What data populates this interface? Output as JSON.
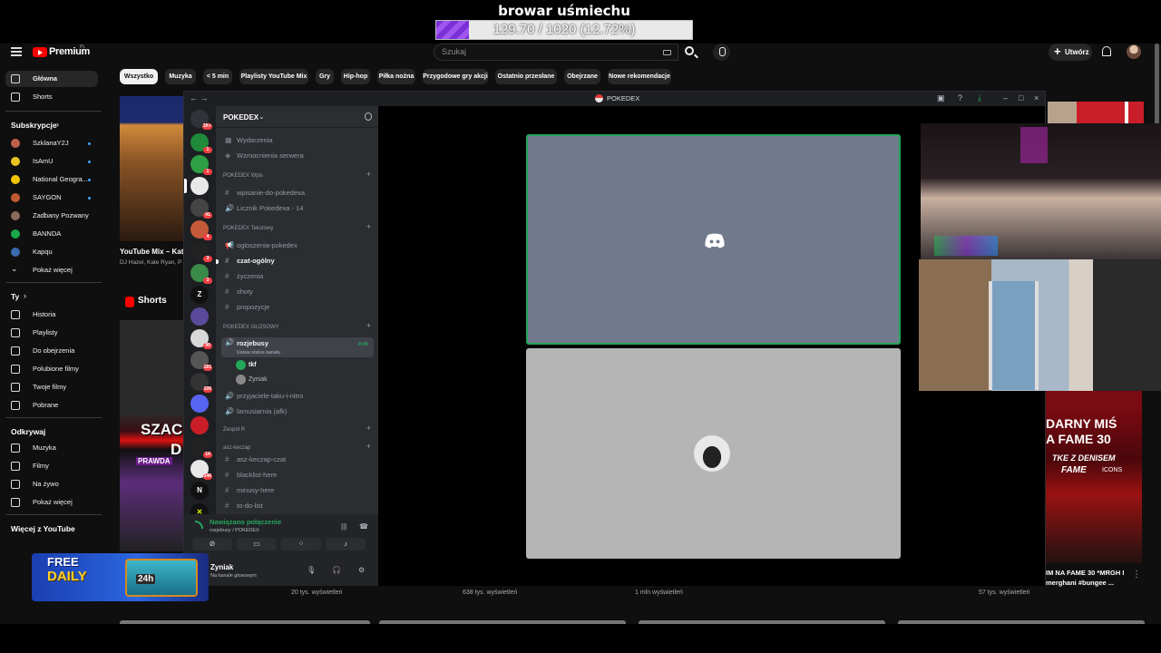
{
  "overlay": {
    "goal_title": "browar uśmiechu",
    "goal_progress_text": "129.70 / 1020 (12.72%)",
    "goal_progress_fraction": 0.1272,
    "accent": "#7b2fd6"
  },
  "youtube": {
    "logo_text": "Premium",
    "logo_region": "PL",
    "search_placeholder": "Szukaj",
    "create_label": "Utwórz",
    "sidebar": {
      "main": [
        {
          "label": "Główna",
          "icon": "home-icon",
          "active": true
        },
        {
          "label": "Shorts",
          "icon": "shorts-icon"
        }
      ],
      "subscriptions_header": "Subskrypcje",
      "subscriptions": [
        {
          "label": "SzklanaY2J",
          "live": true,
          "color": "#c0604a"
        },
        {
          "label": "IsAmU",
          "live": true,
          "color": "#e8c520"
        },
        {
          "label": "National Geogra...",
          "live": true,
          "color": "#f5c400"
        },
        {
          "label": "SAYGON",
          "live": true,
          "color": "#c05a30"
        },
        {
          "label": "Zadbany Pozwany",
          "live": false,
          "color": "#8a6a5a"
        },
        {
          "label": "BANNDA",
          "live": false,
          "color": "#1aa84a"
        },
        {
          "label": "Kapqu",
          "live": false,
          "color": "#3a6ab0"
        },
        {
          "label": "Pokaż więcej",
          "live": false,
          "color": ""
        }
      ],
      "you_header": "Ty",
      "you": [
        {
          "label": "Historia",
          "icon": "history-icon"
        },
        {
          "label": "Playlisty",
          "icon": "playlist-icon"
        },
        {
          "label": "Do obejrzenia",
          "icon": "clock-icon"
        },
        {
          "label": "Polubione filmy",
          "icon": "like-icon"
        },
        {
          "label": "Twoje filmy",
          "icon": "video-icon"
        },
        {
          "label": "Pobrane",
          "icon": "download-icon"
        }
      ],
      "explore_header": "Odkrywaj",
      "explore": [
        {
          "label": "Muzyka",
          "icon": "music-icon"
        },
        {
          "label": "Filmy",
          "icon": "film-icon"
        },
        {
          "label": "Na żywo",
          "icon": "live-icon"
        },
        {
          "label": "Pokaż więcej",
          "icon": "chevron-down-icon"
        }
      ],
      "more_header": "Więcej z YouTube"
    },
    "chips": [
      "Wszystko",
      "Muzyka",
      "< 5 min",
      "Playlisty YouTube Mix",
      "Gry",
      "Hip-hop",
      "Piłka nożna",
      "Przygodowe gry akcji",
      "Ostatnio przesłane",
      "Obejrzane",
      "Nowe rekomendacje"
    ],
    "left_video_title": "YouTube Mix – Kate",
    "left_video_sub": "DJ Hazel, Kate Ryan, P",
    "shorts_title": "Shorts",
    "short_text_1": "SZAC",
    "short_text_1b": "D",
    "short_text_2": "PRAWDA",
    "views": [
      "20 tys. wyświetleń",
      "638 tys. wyświetleń",
      "1 mln wyświetleń",
      "57 tys. wyświetleń"
    ],
    "fame": {
      "line1": "DARNY MIŚ",
      "line2": "A FAME 30",
      "line3": "TKE Z DENISEM",
      "logo": "FAME",
      "icons": "ICONS",
      "title": "IM NA FAME 30 *MRGH I merghani #bungee ..."
    }
  },
  "discord": {
    "window_title": "POKEDEX",
    "server_name": "POKEDEX",
    "guild_badges": [
      "1K+",
      "1",
      "1",
      "",
      "41",
      "4",
      "3",
      "3",
      "",
      "",
      "99",
      "181",
      "106",
      "",
      "",
      "14",
      "346",
      "",
      ""
    ],
    "top_items": [
      "Wydarzenia",
      "Wzmocnienia serwera"
    ],
    "categories": {
      "wpis": "POKEDEX Wpis",
      "text": "POKEDEX Tekstowy",
      "voice": "POKEDEX GŁOSOWY",
      "zespol": "Zespół R",
      "asz": "asz-keczap"
    },
    "channels_wpis": [
      "wpisanie-do-pokedexa",
      "Licznik Pokedexa - 14"
    ],
    "channels_text": [
      "ogloszenia-pokedex",
      "czat-ogólny",
      "życzenia",
      "shoty",
      "propozycje"
    ],
    "voice_channel": {
      "name": "rozjebusy",
      "status": "Ustaw status kanału",
      "time": "8:06"
    },
    "voice_users": [
      "tkf",
      "Zyniak"
    ],
    "voice_channels_more": [
      "przyjaciele-taku-i-nitro",
      "lamusiarnia (afk)"
    ],
    "asz_channels": [
      "asz-keczap-czat",
      "blacklist-here",
      "minusy-here",
      "to-do-list"
    ],
    "connection_status": "Nawiązano połączenie",
    "connection_sub": "rozjebusy / POKEDEX",
    "user_name": "Zyniak",
    "user_sub": "Na kanale głosowym",
    "green": "#23a55a"
  },
  "promo": {
    "free": "FREE",
    "daily": "DAILY",
    "timer": "24h"
  }
}
